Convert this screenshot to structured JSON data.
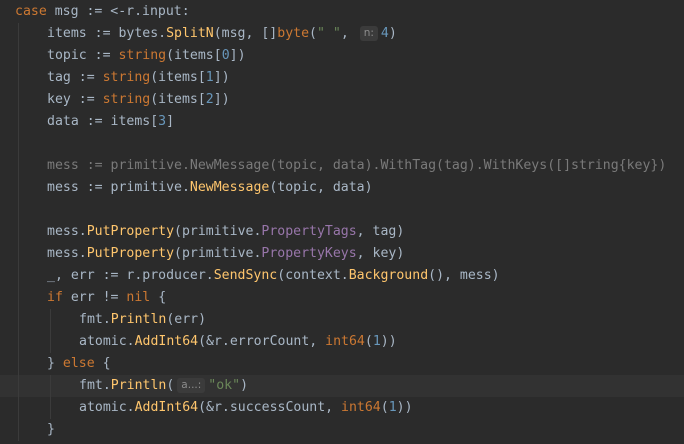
{
  "lines": [
    {
      "indent": 0,
      "tokens": [
        {
          "t": "case",
          "c": "kw"
        },
        {
          "t": " msg := <-r.input:",
          "c": "plain"
        }
      ]
    },
    {
      "indent": 1,
      "tokens": [
        {
          "t": "items := bytes.",
          "c": "plain"
        },
        {
          "t": "SplitN",
          "c": "fn"
        },
        {
          "t": "(msg, []",
          "c": "plain"
        },
        {
          "t": "byte",
          "c": "ty"
        },
        {
          "t": "(",
          "c": "plain"
        },
        {
          "t": "\" \"",
          "c": "str"
        },
        {
          "t": ", ",
          "c": "plain"
        },
        {
          "hint": "n:"
        },
        {
          "t": "4",
          "c": "num"
        },
        {
          "t": ")",
          "c": "plain"
        }
      ]
    },
    {
      "indent": 1,
      "tokens": [
        {
          "t": "topic := ",
          "c": "plain"
        },
        {
          "t": "string",
          "c": "ty"
        },
        {
          "t": "(items[",
          "c": "plain"
        },
        {
          "t": "0",
          "c": "num"
        },
        {
          "t": "])",
          "c": "plain"
        }
      ]
    },
    {
      "indent": 1,
      "tokens": [
        {
          "t": "tag := ",
          "c": "plain"
        },
        {
          "t": "string",
          "c": "ty"
        },
        {
          "t": "(items[",
          "c": "plain"
        },
        {
          "t": "1",
          "c": "num"
        },
        {
          "t": "])",
          "c": "plain"
        }
      ]
    },
    {
      "indent": 1,
      "tokens": [
        {
          "t": "key := ",
          "c": "plain"
        },
        {
          "t": "string",
          "c": "ty"
        },
        {
          "t": "(items[",
          "c": "plain"
        },
        {
          "t": "2",
          "c": "num"
        },
        {
          "t": "])",
          "c": "plain"
        }
      ]
    },
    {
      "indent": 1,
      "tokens": [
        {
          "t": "data := items[",
          "c": "plain"
        },
        {
          "t": "3",
          "c": "num"
        },
        {
          "t": "]",
          "c": "plain"
        }
      ]
    },
    {
      "indent": 1,
      "tokens": []
    },
    {
      "indent": 1,
      "tokens": [
        {
          "t": "mess := primitive.NewMessage(topic, data).WithTag(tag).WithKeys([]string{key})",
          "c": "dim"
        }
      ]
    },
    {
      "indent": 1,
      "tokens": [
        {
          "t": "mess := primitive.",
          "c": "plain"
        },
        {
          "t": "NewMessage",
          "c": "fn"
        },
        {
          "t": "(topic, data)",
          "c": "plain"
        }
      ]
    },
    {
      "indent": 1,
      "tokens": []
    },
    {
      "indent": 1,
      "tokens": [
        {
          "t": "mess.",
          "c": "plain"
        },
        {
          "t": "PutProperty",
          "c": "fn"
        },
        {
          "t": "(primitive.",
          "c": "plain"
        },
        {
          "t": "PropertyTags",
          "c": "prop"
        },
        {
          "t": ", tag)",
          "c": "plain"
        }
      ]
    },
    {
      "indent": 1,
      "tokens": [
        {
          "t": "mess.",
          "c": "plain"
        },
        {
          "t": "PutProperty",
          "c": "fn"
        },
        {
          "t": "(primitive.",
          "c": "plain"
        },
        {
          "t": "PropertyKeys",
          "c": "prop"
        },
        {
          "t": ", key)",
          "c": "plain"
        }
      ]
    },
    {
      "indent": 1,
      "tokens": [
        {
          "t": "_, err := r.producer.",
          "c": "plain"
        },
        {
          "t": "SendSync",
          "c": "fn"
        },
        {
          "t": "(context.",
          "c": "plain"
        },
        {
          "t": "Background",
          "c": "fn"
        },
        {
          "t": "(), mess)",
          "c": "plain"
        }
      ]
    },
    {
      "indent": 1,
      "tokens": [
        {
          "t": "if",
          "c": "kw"
        },
        {
          "t": " err != ",
          "c": "plain"
        },
        {
          "t": "nil",
          "c": "kw"
        },
        {
          "t": " {",
          "c": "plain"
        }
      ]
    },
    {
      "indent": 2,
      "tokens": [
        {
          "t": "fmt.",
          "c": "plain"
        },
        {
          "t": "Println",
          "c": "fn"
        },
        {
          "t": "(err)",
          "c": "plain"
        }
      ]
    },
    {
      "indent": 2,
      "tokens": [
        {
          "t": "atomic.",
          "c": "plain"
        },
        {
          "t": "AddInt64",
          "c": "fn"
        },
        {
          "t": "(&r.errorCount, ",
          "c": "plain"
        },
        {
          "t": "int64",
          "c": "ty"
        },
        {
          "t": "(",
          "c": "plain"
        },
        {
          "t": "1",
          "c": "num"
        },
        {
          "t": "))",
          "c": "plain"
        }
      ]
    },
    {
      "indent": 1,
      "tokens": [
        {
          "t": "} ",
          "c": "plain"
        },
        {
          "t": "else",
          "c": "kw"
        },
        {
          "t": " {",
          "c": "plain"
        }
      ]
    },
    {
      "indent": 2,
      "current": true,
      "tokens": [
        {
          "t": "fmt.",
          "c": "plain"
        },
        {
          "t": "Println",
          "c": "fn"
        },
        {
          "t": "(",
          "c": "plain"
        },
        {
          "hint": "a...:"
        },
        {
          "t": "\"ok\"",
          "c": "str"
        },
        {
          "t": ")",
          "c": "plain"
        }
      ]
    },
    {
      "indent": 2,
      "tokens": [
        {
          "t": "atomic.",
          "c": "plain"
        },
        {
          "t": "AddInt64",
          "c": "fn"
        },
        {
          "t": "(&r.successCount, ",
          "c": "plain"
        },
        {
          "t": "int64",
          "c": "ty"
        },
        {
          "t": "(",
          "c": "plain"
        },
        {
          "t": "1",
          "c": "num"
        },
        {
          "t": "))",
          "c": "plain"
        }
      ]
    },
    {
      "indent": 1,
      "tokens": [
        {
          "t": "}",
          "c": "plain"
        }
      ]
    }
  ]
}
